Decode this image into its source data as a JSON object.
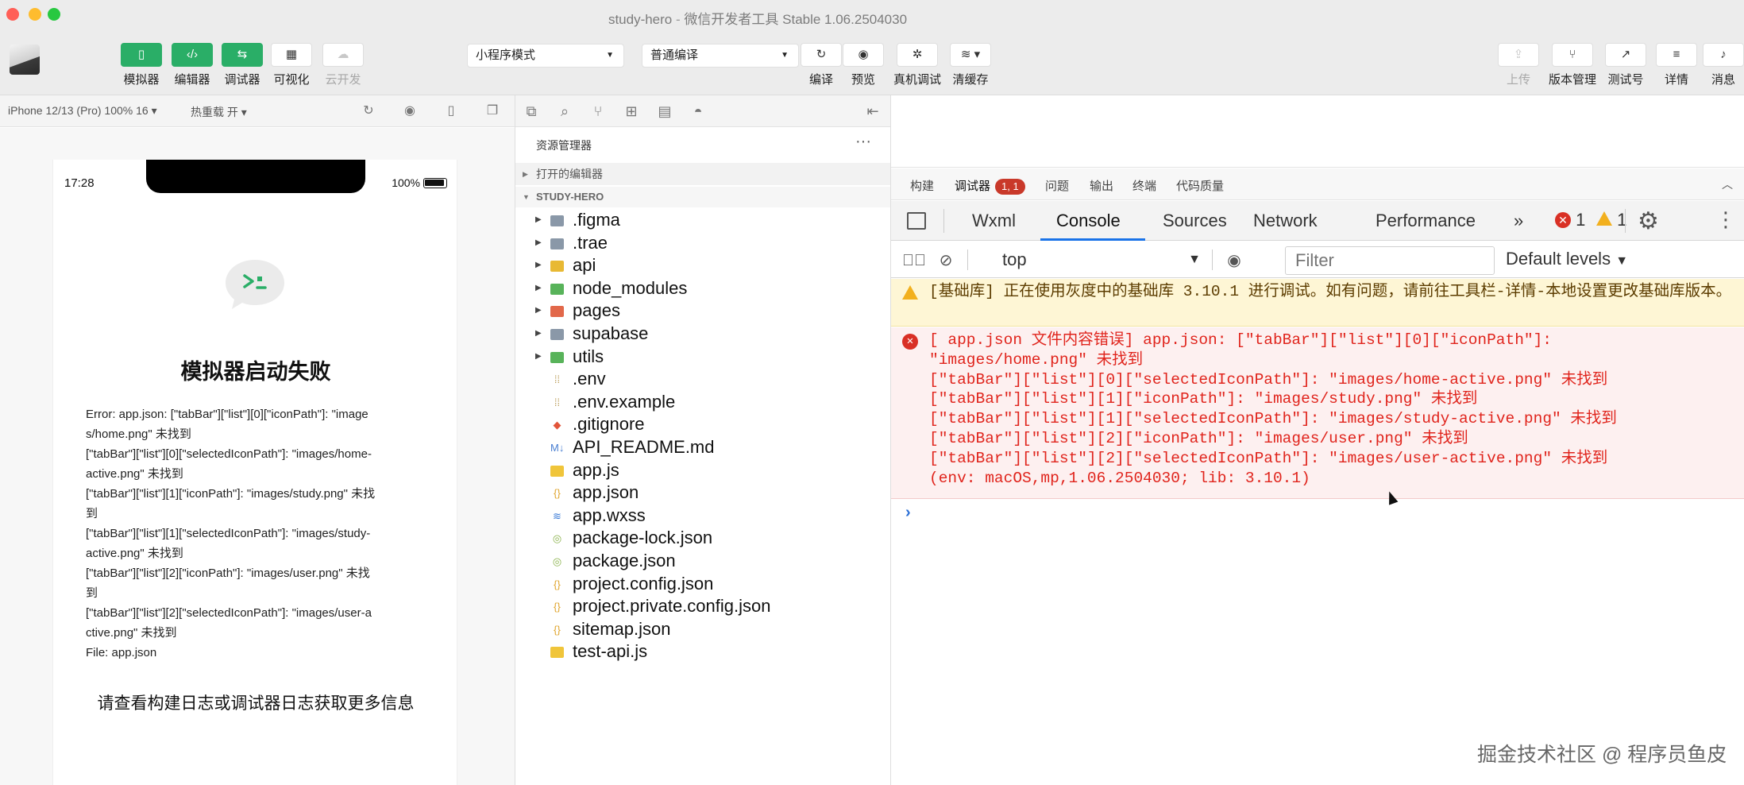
{
  "window": {
    "title": "study-hero",
    "separator": "-",
    "subtitle": "微信开发者工具 Stable 1.06.2504030"
  },
  "toolbar": {
    "left_buttons": [
      {
        "label": "模拟器",
        "icon": "phone-icon"
      },
      {
        "label": "编辑器",
        "icon": "code-icon"
      },
      {
        "label": "调试器",
        "icon": "debug-icon"
      },
      {
        "label": "可视化",
        "icon": "layout-icon"
      },
      {
        "label": "云开发",
        "icon": "cloud-icon"
      }
    ],
    "mode_select": "小程序模式",
    "compile_select": "普通编译",
    "mid_buttons": [
      {
        "label": "编译",
        "icon": "refresh-icon"
      },
      {
        "label": "预览",
        "icon": "eye-icon"
      },
      {
        "label": "真机调试",
        "icon": "bug-icon"
      },
      {
        "label": "清缓存",
        "icon": "layers-icon"
      }
    ],
    "right_buttons": [
      {
        "label": "上传",
        "icon": "upload-icon"
      },
      {
        "label": "版本管理",
        "icon": "branch-icon"
      },
      {
        "label": "测试号",
        "icon": "external-link-icon"
      },
      {
        "label": "详情",
        "icon": "menu-icon"
      },
      {
        "label": "消息",
        "icon": "bell-icon"
      }
    ]
  },
  "simulator": {
    "device": "iPhone 12/13 (Pro) 100% 16 ▾",
    "hot_reload": "热重载 开 ▾",
    "time": "17:28",
    "battery": "100%",
    "error_title": "模拟器启动失败",
    "error_lines": [
      "Error: app.json: [\"tabBar\"][\"list\"][0][\"iconPath\"]: \"image",
      "s/home.png\" 未找到",
      "[\"tabBar\"][\"list\"][0][\"selectedIconPath\"]: \"images/home-",
      "active.png\" 未找到",
      "[\"tabBar\"][\"list\"][1][\"iconPath\"]: \"images/study.png\" 未找",
      "到",
      "[\"tabBar\"][\"list\"][1][\"selectedIconPath\"]: \"images/study-",
      "active.png\" 未找到",
      "[\"tabBar\"][\"list\"][2][\"iconPath\"]: \"images/user.png\" 未找",
      "到",
      "[\"tabBar\"][\"list\"][2][\"selectedIconPath\"]: \"images/user-a",
      "ctive.png\" 未找到",
      "File: app.json"
    ],
    "footer": "请查看构建日志或调试器日志获取更多信息"
  },
  "explorer": {
    "header": "资源管理器",
    "more": "···",
    "open_editors": "打开的编辑器",
    "project": "STUDY-HERO",
    "items": [
      {
        "name": ".figma",
        "type": "folder",
        "color": "#8a98a8"
      },
      {
        "name": ".trae",
        "type": "folder",
        "color": "#8a98a8"
      },
      {
        "name": "api",
        "type": "folder",
        "color": "#e8b934"
      },
      {
        "name": "node_modules",
        "type": "folder",
        "color": "#58b35a"
      },
      {
        "name": "pages",
        "type": "folder",
        "color": "#e2684a"
      },
      {
        "name": "supabase",
        "type": "folder",
        "color": "#8a98a8"
      },
      {
        "name": "utils",
        "type": "folder",
        "color": "#58b35a"
      },
      {
        "name": ".env",
        "type": "file",
        "icon": "settings-file-icon"
      },
      {
        "name": ".env.example",
        "type": "file",
        "icon": "settings-file-icon"
      },
      {
        "name": ".gitignore",
        "type": "file",
        "icon": "git-icon"
      },
      {
        "name": "API_README.md",
        "type": "file",
        "icon": "markdown-icon"
      },
      {
        "name": "app.js",
        "type": "file",
        "icon": "js-icon"
      },
      {
        "name": "app.json",
        "type": "file",
        "icon": "json-icon"
      },
      {
        "name": "app.wxss",
        "type": "file",
        "icon": "css-icon"
      },
      {
        "name": "package-lock.json",
        "type": "file",
        "icon": "npm-icon"
      },
      {
        "name": "package.json",
        "type": "file",
        "icon": "npm-icon"
      },
      {
        "name": "project.config.json",
        "type": "file",
        "icon": "json-icon"
      },
      {
        "name": "project.private.config.json",
        "type": "file",
        "icon": "json-icon"
      },
      {
        "name": "sitemap.json",
        "type": "file",
        "icon": "json-icon"
      },
      {
        "name": "test-api.js",
        "type": "file",
        "icon": "js-icon"
      }
    ]
  },
  "devtools": {
    "top_tabs": [
      {
        "label": "构建"
      },
      {
        "label": "调试器",
        "badge": "1, 1"
      },
      {
        "label": "问题"
      },
      {
        "label": "输出"
      },
      {
        "label": "终端"
      },
      {
        "label": "代码质量"
      }
    ],
    "panel_tabs": [
      "Wxml",
      "Console",
      "Sources",
      "Network",
      "Performance"
    ],
    "more_tabs": "»",
    "error_count": "1",
    "warning_count": "1",
    "context": "top",
    "filter_placeholder": "Filter",
    "levels": "Default levels",
    "warning_message": "[基础库] 正在使用灰度中的基础库 3.10.1 进行调试。如有问题，请前往工具栏-详情-本地设置更改基础库版本。",
    "error_message": "[ app.json 文件内容错误] app.json: [\"tabBar\"][\"list\"][0][\"iconPath\"]:\n\"images/home.png\" 未找到\n[\"tabBar\"][\"list\"][0][\"selectedIconPath\"]: \"images/home-active.png\" 未找到\n[\"tabBar\"][\"list\"][1][\"iconPath\"]: \"images/study.png\" 未找到\n[\"tabBar\"][\"list\"][1][\"selectedIconPath\"]: \"images/study-active.png\" 未找到\n[\"tabBar\"][\"list\"][2][\"iconPath\"]: \"images/user.png\" 未找到\n[\"tabBar\"][\"list\"][2][\"selectedIconPath\"]: \"images/user-active.png\" 未找到\n(env: macOS,mp,1.06.2504030; lib: 3.10.1)",
    "prompt": "›"
  },
  "watermark": "掘金技术社区 @ 程序员鱼皮",
  "colors": {
    "accent_green": "#2aae67",
    "error_red": "#e0241c",
    "warning_bg": "#fef6d5",
    "tab_blue": "#1a73e8"
  }
}
